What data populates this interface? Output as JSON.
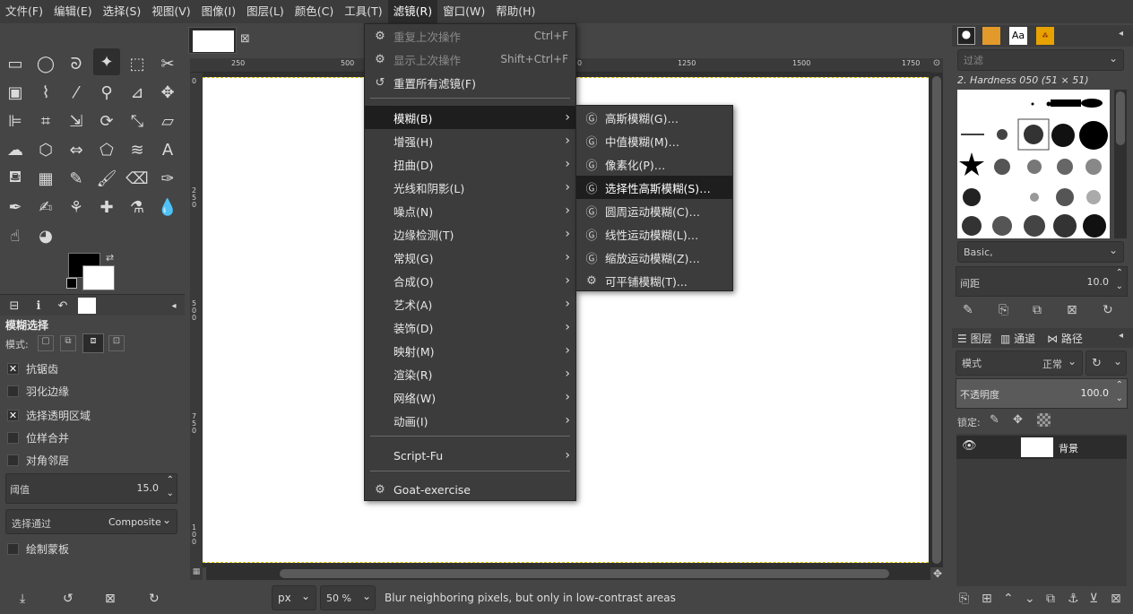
{
  "menubar": {
    "items": [
      "文件(F)",
      "编辑(E)",
      "选择(S)",
      "视图(V)",
      "图像(I)",
      "图层(L)",
      "颜色(C)",
      "工具(T)",
      "滤镜(R)",
      "窗口(W)",
      "帮助(H)"
    ],
    "active": "滤镜(R)"
  },
  "filters_menu": {
    "repeat_last": {
      "label": "重复上次操作",
      "shortcut": "Ctrl+F"
    },
    "reshow_last": {
      "label": "显示上次操作",
      "shortcut": "Shift+Ctrl+F"
    },
    "reset_all": {
      "label": "重置所有滤镜(F)"
    },
    "categories": [
      "模糊(B)",
      "增强(H)",
      "扭曲(D)",
      "光线和阴影(L)",
      "噪点(N)",
      "边缘检测(T)",
      "常规(G)",
      "合成(O)",
      "艺术(A)",
      "装饰(D)",
      "映射(M)",
      "渲染(R)",
      "网络(W)",
      "动画(I)"
    ],
    "script_fu": "Script-Fu",
    "goat": "Goat-exercise"
  },
  "blur_submenu": {
    "items": [
      "高斯模糊(G)…",
      "中值模糊(M)…",
      "像素化(P)…",
      "选择性高斯模糊(S)…",
      "圆周运动模糊(C)…",
      "线性运动模糊(L)…",
      "缩放运动模糊(Z)…",
      "可平铺模糊(T)..."
    ],
    "highlighted": "选择性高斯模糊(S)…"
  },
  "tool_options": {
    "title": "模糊选择",
    "mode_label": "模式:",
    "antialias": "抗锯齿",
    "feather": "羽化边缘",
    "select_transparent": "选择透明区域",
    "sample_merged": "位样合并",
    "diagonal": "对角邻居",
    "threshold_label": "阈值",
    "threshold_value": "15.0",
    "select_by_label": "选择通过",
    "select_by_value": "Composite",
    "draw_mask": "绘制蒙板"
  },
  "ruler": {
    "top_ticks": [
      "250",
      "500",
      "0",
      "1250",
      "1500",
      "1750"
    ],
    "left_ticks": [
      "0",
      "2 5 0",
      "5 0 0",
      "7 5 0",
      "1 0 0"
    ]
  },
  "statusbar": {
    "unit": "px",
    "zoom": "50 %",
    "message": "Blur neighboring pixels, but only in low-contrast areas"
  },
  "brushes": {
    "filter_placeholder": "过滤",
    "current_brush": "2. Hardness 050 (51 × 51)",
    "tag": "Basic,",
    "spacing_label": "间距",
    "spacing_value": "10.0"
  },
  "layers": {
    "tabs": [
      "图层",
      "通道",
      "路径"
    ],
    "mode_label": "模式",
    "mode_value": "正常",
    "opacity_label": "不透明度",
    "opacity_value": "100.0",
    "lock_label": "锁定:",
    "layer_name": "背景"
  },
  "colors": {
    "foreground": "#000000",
    "background": "#ffffff",
    "menu_highlight": "#1e1e1e",
    "selection_marching": "#d8c200"
  }
}
